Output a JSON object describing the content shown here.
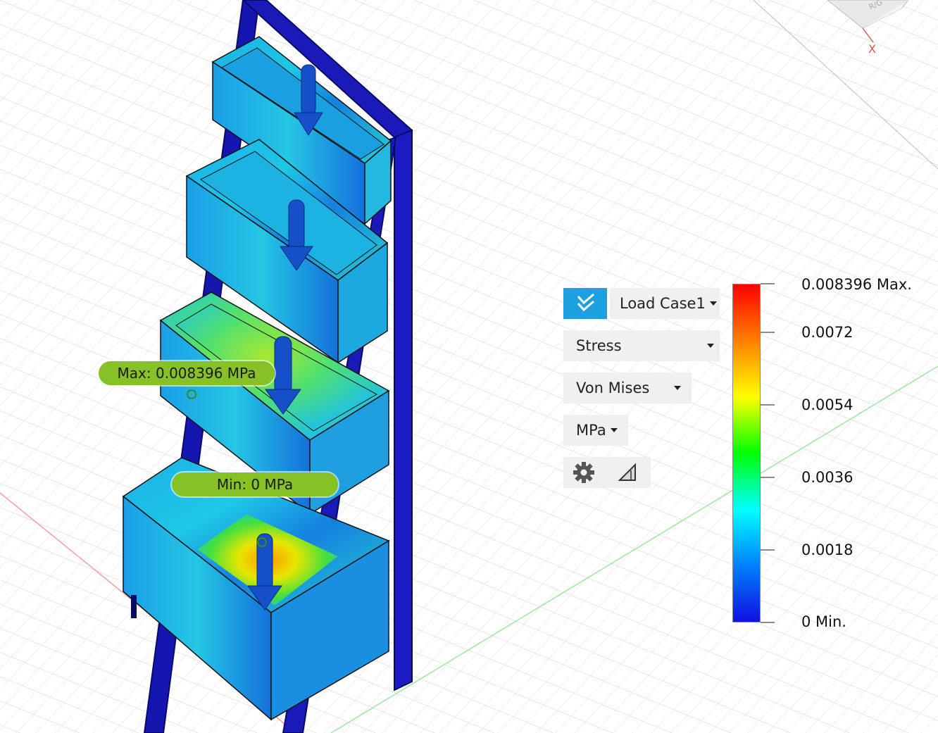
{
  "view_cube": {
    "axis_label": "X",
    "face_label": "R/G"
  },
  "result_panel": {
    "load_case": {
      "label": "Load Case1"
    },
    "result_type": {
      "label": "Stress"
    },
    "component": {
      "label": "Von Mises"
    },
    "units": {
      "label": "MPa"
    },
    "icons": {
      "expand": "double-chevron-down-icon",
      "settings": "gear-icon",
      "slicer": "triangle-ruler-icon"
    }
  },
  "legend": {
    "max_label": "0.008396 Max.",
    "ticks": [
      "0.0072",
      "0.0054",
      "0.0036",
      "0.0018"
    ],
    "min_label": "0 Min.",
    "gradient": [
      "#ff0000",
      "#ff7f00",
      "#ffff00",
      "#00ff00",
      "#00ffff",
      "#0080ff",
      "#1010e0"
    ]
  },
  "probes": {
    "max": {
      "text": "Max: 0.008396 MPa"
    },
    "min": {
      "text": "Min: 0 MPa"
    }
  },
  "colors": {
    "accent": "#1e9fe0",
    "probe": "#86c226",
    "frame": "#1a1ab8"
  }
}
